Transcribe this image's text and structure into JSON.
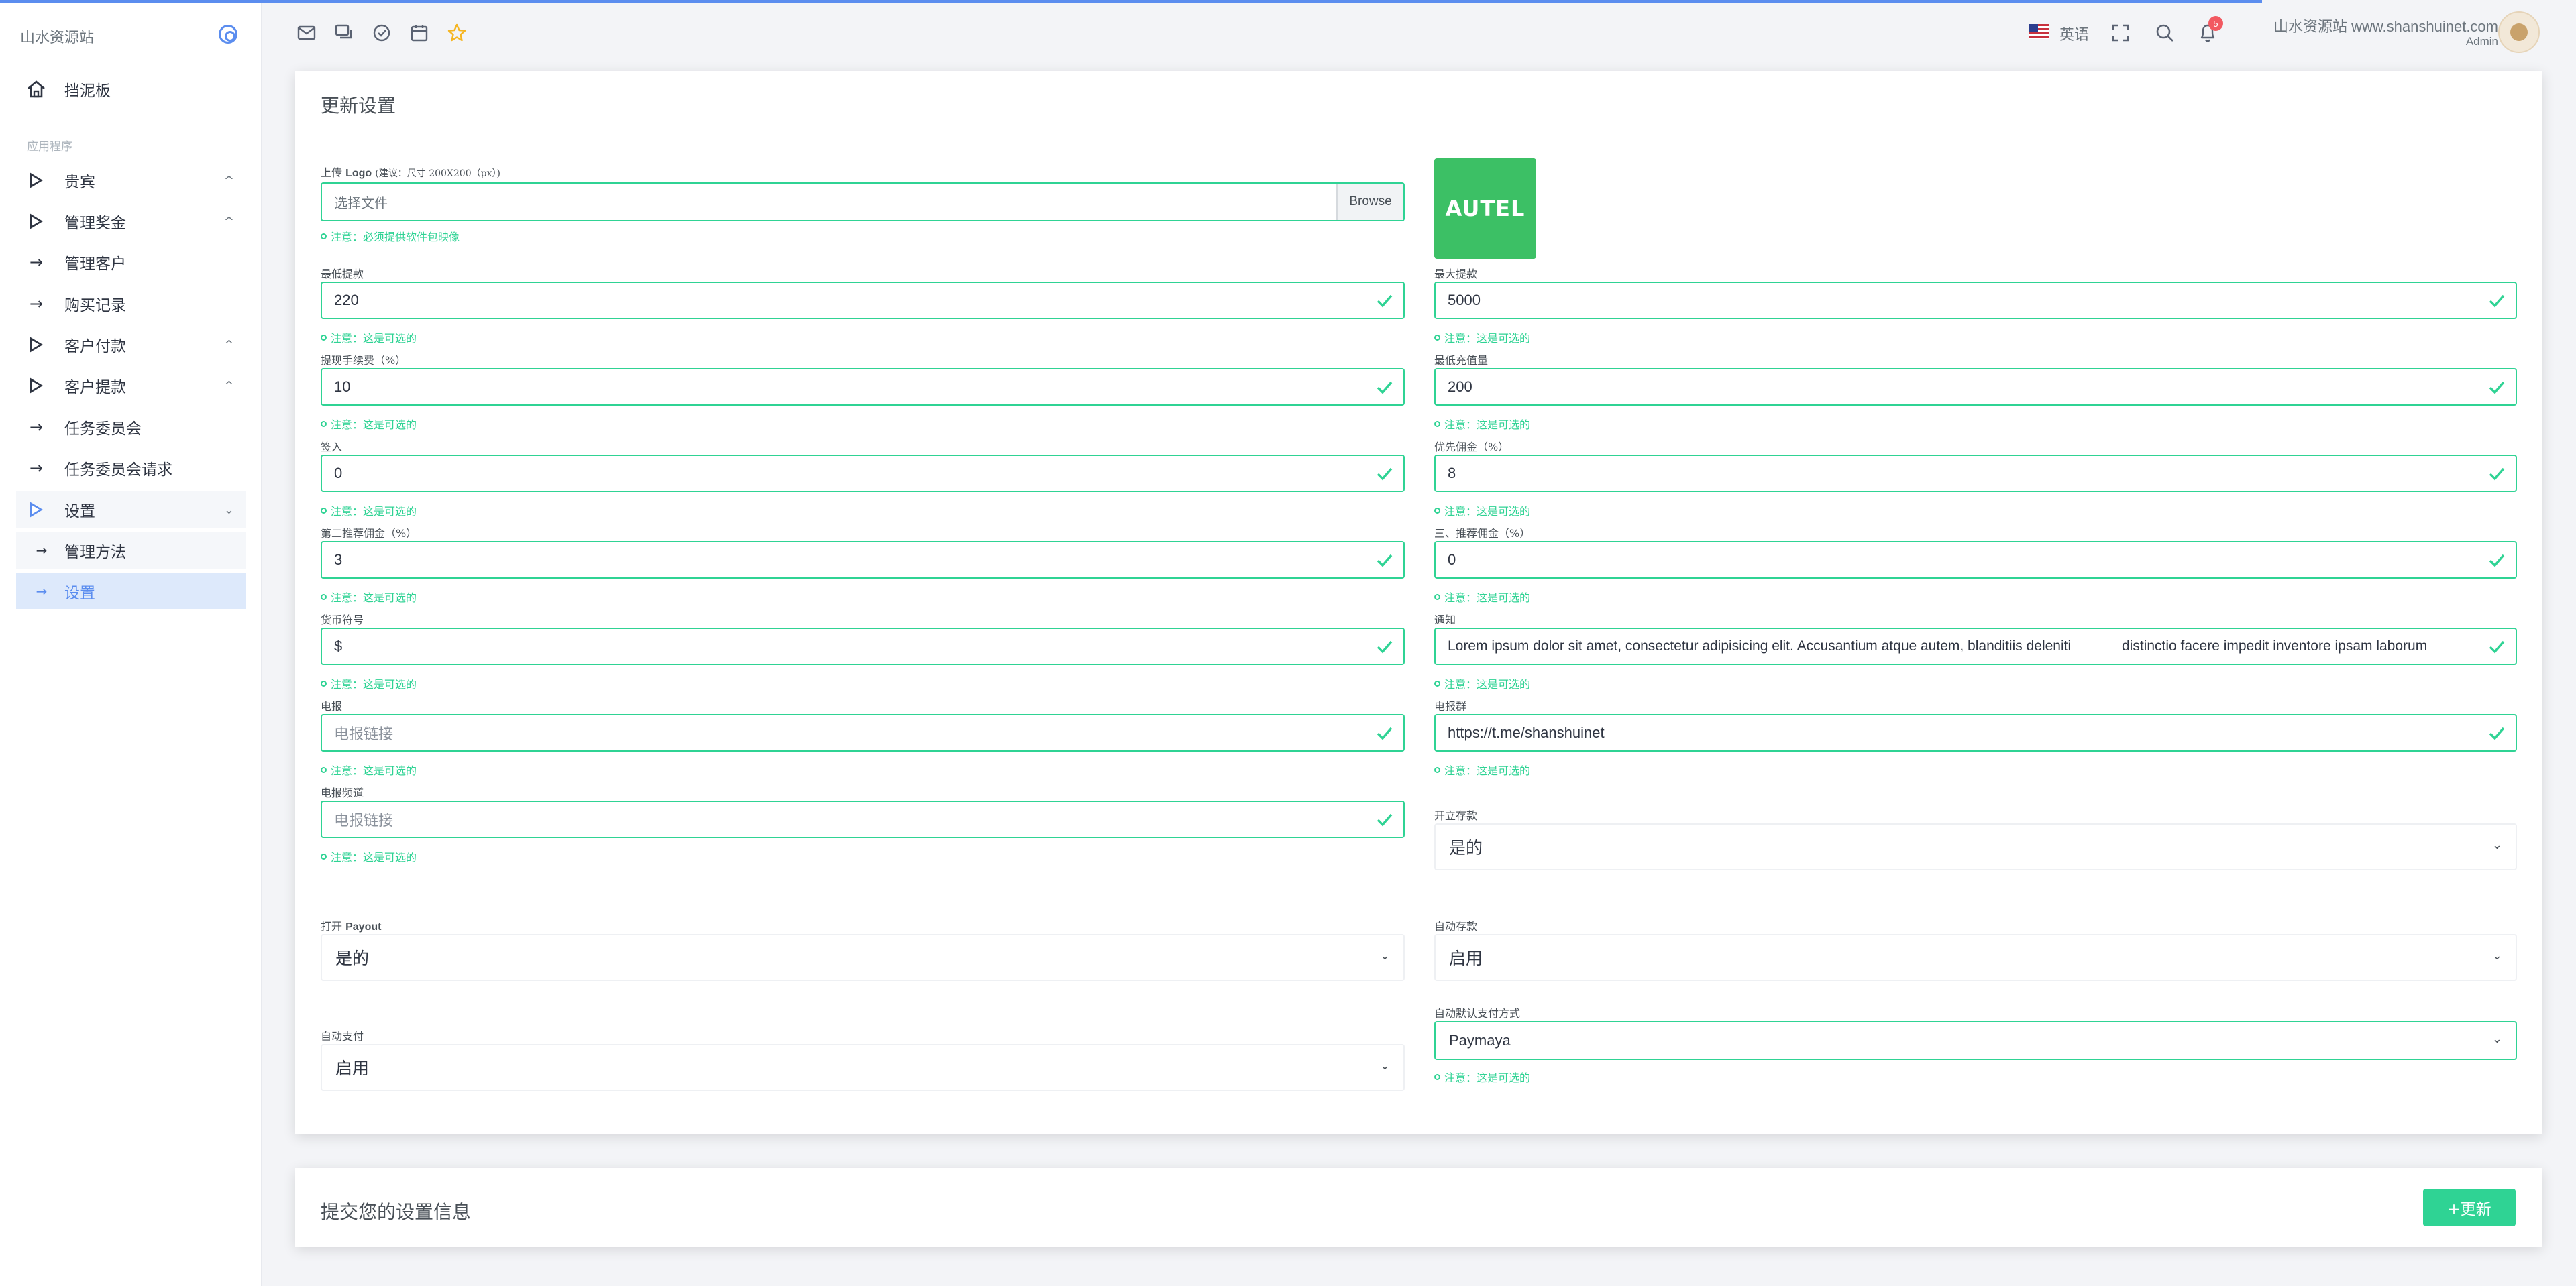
{
  "app": {
    "brand": "山水资源站"
  },
  "sidebar": {
    "dashboard": "挡泥板",
    "section": "应用程序",
    "items": [
      {
        "label": "贵宾",
        "chevron": "^"
      },
      {
        "label": "管理奖金",
        "chevron": "^"
      },
      {
        "label": "管理客户"
      },
      {
        "label": "购买记录"
      },
      {
        "label": "客户付款",
        "chevron": "^"
      },
      {
        "label": "客户提款",
        "chevron": "^"
      },
      {
        "label": "任务委员会"
      },
      {
        "label": "任务委员会请求"
      },
      {
        "label": "设置",
        "chevron": "⌄"
      },
      {
        "label": "管理方法"
      },
      {
        "label": "设置"
      }
    ]
  },
  "topbar": {
    "language": "英语",
    "notification_count": "5",
    "user_name": "山水资源站 www.shanshuinet.com",
    "user_role": "Admin"
  },
  "form": {
    "title": "更新设置",
    "logo_label": "上传",
    "logo_label_bold": "Logo",
    "logo_hint": "(建议：尺寸 200X200（px）)",
    "file_placeholder": "选择文件",
    "browse": "Browse",
    "logo_note": "注意：必须提供软件包映像",
    "logo_text": "AUTEL",
    "note_optional": "注意：这是可选的",
    "left": [
      {
        "label": "最低提款",
        "value": "220"
      },
      {
        "label": "提现手续费（%）",
        "value": "10"
      },
      {
        "label": "签入",
        "value": "0"
      },
      {
        "label": "第二推荐佣金（%）",
        "value": "3"
      },
      {
        "label": "货币符号",
        "value": "$"
      },
      {
        "label": "电报",
        "placeholder": "电报链接"
      },
      {
        "label": "电报频道",
        "placeholder": "电报链接"
      }
    ],
    "right": [
      {
        "label": "最大提款",
        "value": "5000"
      },
      {
        "label": "最低充值量",
        "value": "200"
      },
      {
        "label": "优先佣金（%）",
        "value": "8"
      },
      {
        "label": "三、推荐佣金（%）",
        "value": "0"
      },
      {
        "label": "通知",
        "value": "Lorem ipsum dolor sit amet, consectetur adipisicing elit. Accusantium atque autem, blanditiis deleniti             distinctio facere impedit inventore ipsam laborum"
      },
      {
        "label": "电报群",
        "value": "https://t.me/shanshuinet"
      }
    ],
    "open_deposit": {
      "label": "开立存款",
      "value": "是的"
    },
    "open_payout": {
      "label": "打开",
      "label_bold": "Payout",
      "value": "是的"
    },
    "auto_deposit": {
      "label": "自动存款",
      "value": "启用"
    },
    "auto_payment": {
      "label": "自动支付",
      "value": "启用"
    },
    "auto_default_payment": {
      "label": "自动默认支付方式",
      "value": "Paymaya"
    }
  },
  "submit": {
    "title": "提交您的设置信息",
    "button": "+更新"
  },
  "colors": {
    "accent": "#2fd394",
    "primary": "#5b8def"
  }
}
